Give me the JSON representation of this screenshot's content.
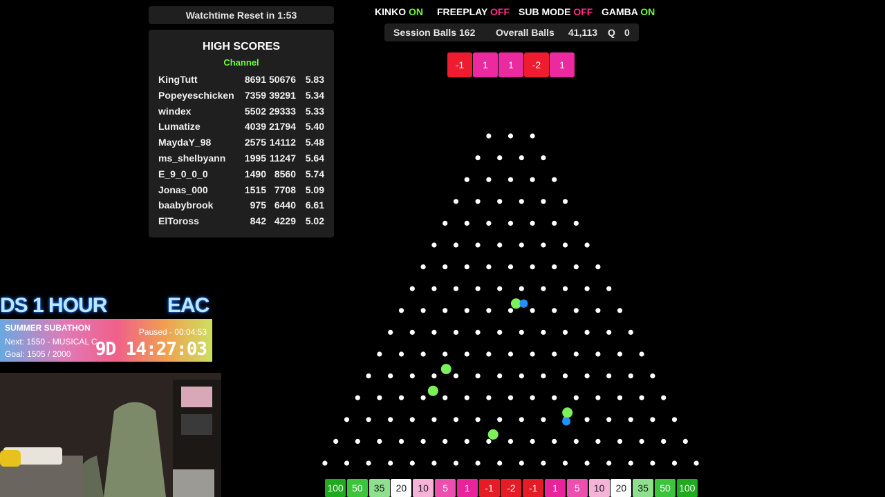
{
  "watchtime": {
    "label": "Watchtime Reset in",
    "time": "1:53"
  },
  "high_scores": {
    "title": "HIGH SCORES",
    "subtitle": "Channel",
    "rows": [
      {
        "name": "KingTutt",
        "a": "8691",
        "b": "50676",
        "c": "5.83"
      },
      {
        "name": "Popeyeschicken",
        "a": "7359",
        "b": "39291",
        "c": "5.34"
      },
      {
        "name": "windex",
        "a": "5502",
        "b": "29333",
        "c": "5.33"
      },
      {
        "name": "Lumatize",
        "a": "4039",
        "b": "21794",
        "c": "5.40"
      },
      {
        "name": "MaydaY_98",
        "a": "2575",
        "b": "14112",
        "c": "5.48"
      },
      {
        "name": "ms_shelbyann",
        "a": "1995",
        "b": "11247",
        "c": "5.64"
      },
      {
        "name": "E_9_0_0_0",
        "a": "1490",
        "b": "8560",
        "c": "5.74"
      },
      {
        "name": "Jonas_000",
        "a": "1515",
        "b": "7708",
        "c": "5.09"
      },
      {
        "name": "baabybrook",
        "a": "975",
        "b": "6440",
        "c": "6.61"
      },
      {
        "name": "ElToross",
        "a": "842",
        "b": "4229",
        "c": "5.02"
      }
    ]
  },
  "toggles": [
    {
      "label": "KINKO",
      "state": "ON"
    },
    {
      "label": "FREEPLAY",
      "state": "OFF"
    },
    {
      "label": "SUB MODE",
      "state": "OFF"
    },
    {
      "label": "GAMBA",
      "state": "ON"
    }
  ],
  "stats": {
    "session_label": "Session Balls",
    "session_value": "162",
    "overall_label": "Overall Balls",
    "overall_value": "41,113",
    "queue_label": "Q",
    "queue_value": "0"
  },
  "history": [
    {
      "value": "-1",
      "color": "#ee1c2e"
    },
    {
      "value": "1",
      "color": "#ec2aa0"
    },
    {
      "value": "1",
      "color": "#ec2aa0"
    },
    {
      "value": "-2",
      "color": "#ee1c2e"
    },
    {
      "value": "1",
      "color": "#ec2aa0"
    }
  ],
  "board": {
    "peg_rows": 16,
    "first_row_pegs": 3,
    "balls": [
      {
        "row": 8,
        "peg": 5.25,
        "color": "#7cf05a"
      },
      {
        "row": 8,
        "peg": 5.6,
        "color": "#1e90ff"
      },
      {
        "row": 11,
        "peg": 3.55,
        "color": "#7cf05a"
      },
      {
        "row": 12,
        "peg": 3.45,
        "color": "#7cf05a"
      },
      {
        "row": 13,
        "peg": 10.1,
        "color": "#7cf05a"
      },
      {
        "row": 13.4,
        "peg": 10.05,
        "color": "#1e90ff"
      },
      {
        "row": 14,
        "peg": 7.2,
        "color": "#7cf05a"
      }
    ]
  },
  "slots": [
    {
      "value": "100",
      "bg": "#1faa1f",
      "fg": "#ffffff"
    },
    {
      "value": "50",
      "bg": "#3cc43c",
      "fg": "#ffffff"
    },
    {
      "value": "35",
      "bg": "#8ee08e",
      "fg": "#1a1a1a"
    },
    {
      "value": "20",
      "bg": "#ffffff",
      "fg": "#1a1a1a"
    },
    {
      "value": "10",
      "bg": "#f6b3d8",
      "fg": "#1a1a1a"
    },
    {
      "value": "5",
      "bg": "#ec4fae",
      "fg": "#ffffff"
    },
    {
      "value": "1",
      "bg": "#e9249b",
      "fg": "#ffffff"
    },
    {
      "value": "-1",
      "bg": "#e51b25",
      "fg": "#ffffff"
    },
    {
      "value": "-2",
      "bg": "#e51b25",
      "fg": "#ffffff"
    },
    {
      "value": "-1",
      "bg": "#e51b25",
      "fg": "#ffffff"
    },
    {
      "value": "1",
      "bg": "#e9249b",
      "fg": "#ffffff"
    },
    {
      "value": "5",
      "bg": "#ec4fae",
      "fg": "#ffffff"
    },
    {
      "value": "10",
      "bg": "#f6b3d8",
      "fg": "#1a1a1a"
    },
    {
      "value": "20",
      "bg": "#ffffff",
      "fg": "#1a1a1a"
    },
    {
      "value": "35",
      "bg": "#8ee08e",
      "fg": "#1a1a1a"
    },
    {
      "value": "50",
      "bg": "#3cc43c",
      "fg": "#ffffff"
    },
    {
      "value": "100",
      "bg": "#1faa1f",
      "fg": "#ffffff"
    }
  ],
  "subathon": {
    "banner_left": "DS 1 HOUR",
    "banner_right": "EAC",
    "title": "SUMMER SUBATHON",
    "status": "Paused - 00:04:53",
    "next": "Next: 1550 - MUSICAL C",
    "goal": "Goal: 1505 / 2000",
    "timer": "9D 14:27:03"
  },
  "webcam": {
    "alt": "streamer webcam"
  }
}
